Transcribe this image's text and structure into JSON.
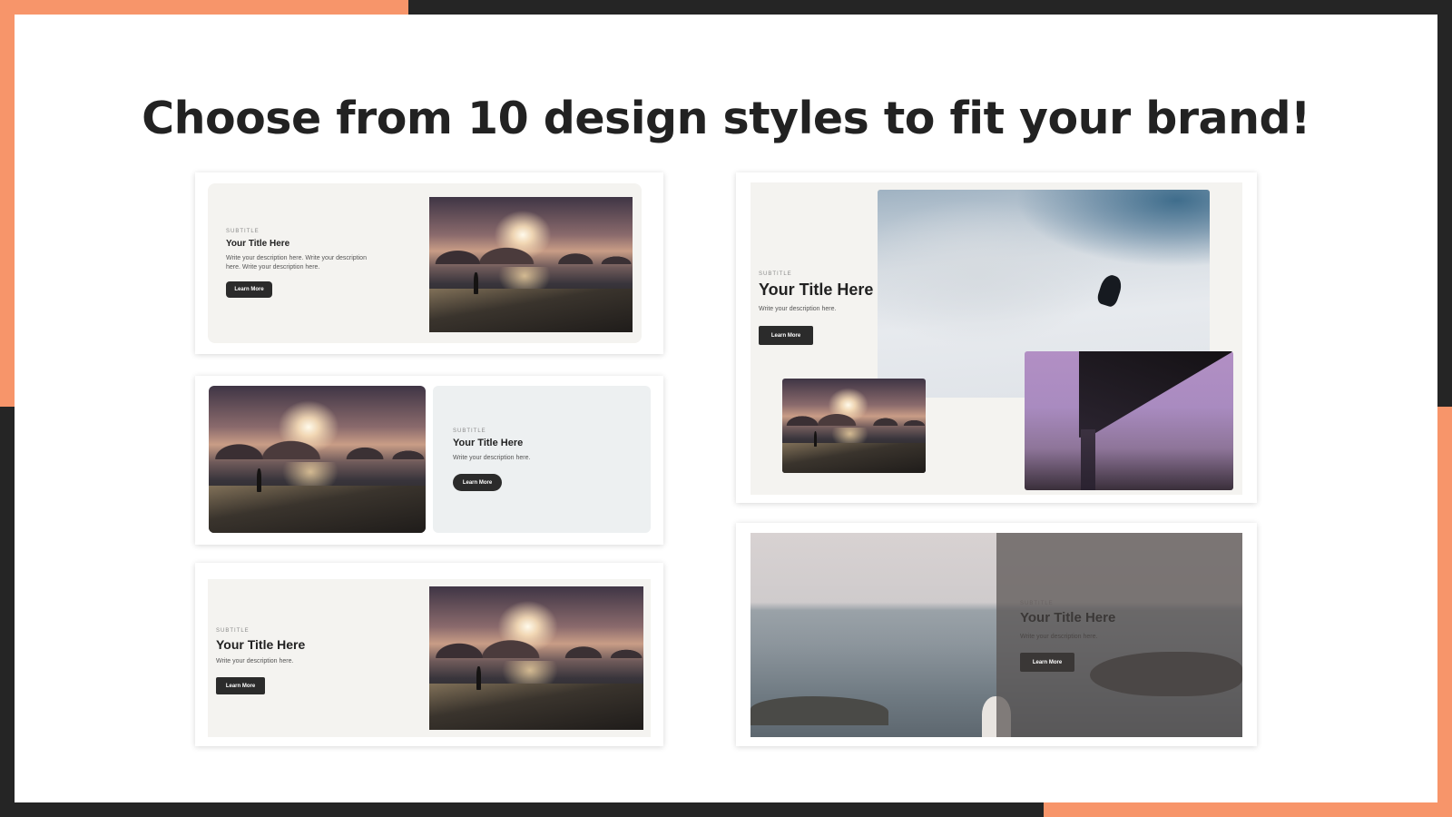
{
  "headline": "Choose from 10 design styles to fit your brand!",
  "colors": {
    "accent": "#f7956a",
    "frame": "#252525",
    "button": "#2b2b2b"
  },
  "previews": [
    {
      "subtitle": "SUBTITLE",
      "title": "Your Title Here",
      "description": "Write your description here. Write your description here. Write your description here.",
      "button": "Learn More",
      "images": [
        "sunset-photo"
      ]
    },
    {
      "subtitle": "SUBTITLE",
      "title": "Your Title Here",
      "description": "Write your description here.",
      "button": "Learn More",
      "images": [
        "sunset-photo"
      ]
    },
    {
      "subtitle": "SUBTITLE",
      "title": "Your Title Here",
      "description": "Write your description here.",
      "button": "Learn More",
      "images": [
        "sunset-photo"
      ]
    },
    {
      "subtitle": "SUBTITLE",
      "title": "Your Title Here",
      "description": "Write your description here.",
      "button": "Learn More",
      "images": [
        "snowboarder-photo",
        "sunset-photo",
        "bridge-photo"
      ]
    },
    {
      "subtitle": "SUBTITLE",
      "title": "Your Title Here",
      "description": "Write your description here.",
      "button": "Learn More",
      "images": [
        "seaside-photo"
      ]
    }
  ]
}
